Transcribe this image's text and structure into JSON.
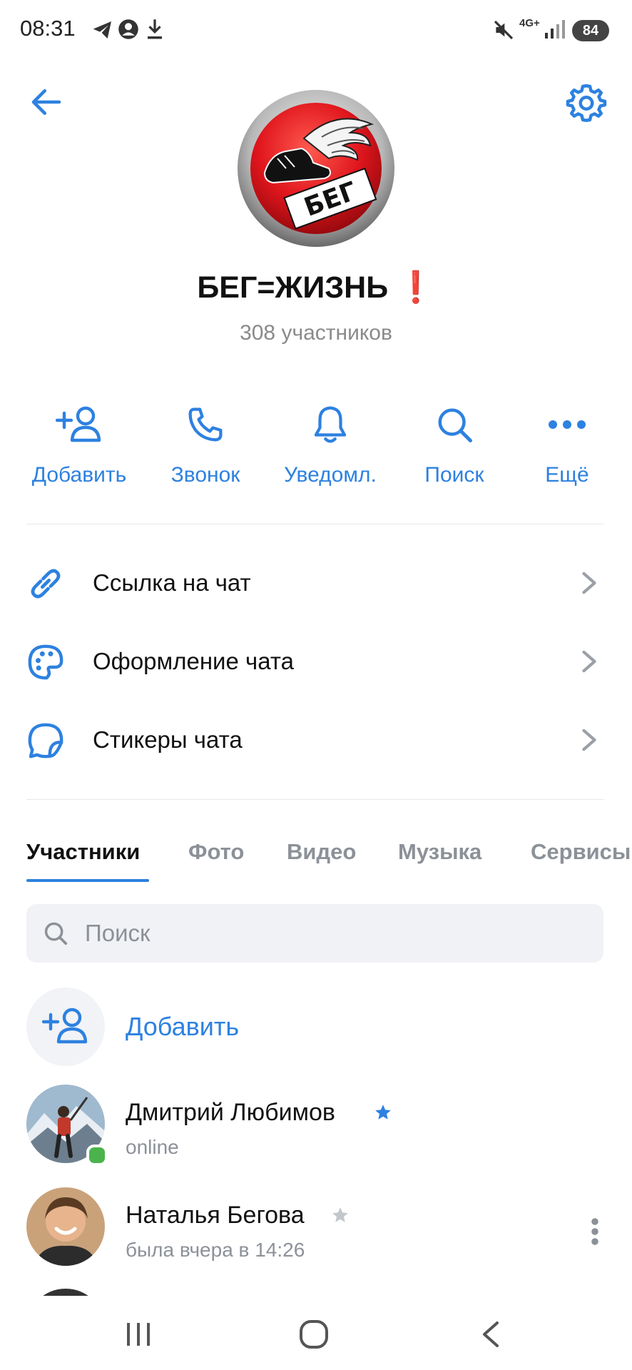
{
  "status_bar": {
    "time": "08:31",
    "network": "4G+",
    "battery": "84"
  },
  "header": {
    "back_icon": "arrow-left-icon",
    "settings_icon": "gear-icon",
    "avatar_text": "БЕГ"
  },
  "chat": {
    "title": "БЕГ=ЖИЗНЬ",
    "title_emoji": "❗",
    "subtitle": "308 участников"
  },
  "actions": [
    {
      "icon": "add-user-icon",
      "label": "Добавить"
    },
    {
      "icon": "phone-icon",
      "label": "Звонок"
    },
    {
      "icon": "bell-icon",
      "label": "Уведомл."
    },
    {
      "icon": "search-icon",
      "label": "Поиск"
    },
    {
      "icon": "more-icon",
      "label": "Ещё"
    }
  ],
  "menu": [
    {
      "icon": "link-icon",
      "label": "Ссылка на чат"
    },
    {
      "icon": "palette-icon",
      "label": "Оформление чата"
    },
    {
      "icon": "sticker-icon",
      "label": "Стикеры чата"
    }
  ],
  "tabs": [
    "Участники",
    "Фото",
    "Видео",
    "Музыка",
    "Сервисы"
  ],
  "active_tab": "Участники",
  "search": {
    "placeholder": "Поиск"
  },
  "add_member": {
    "label": "Добавить"
  },
  "members": [
    {
      "name": "Дмитрий Любимов",
      "status": "online",
      "star": "filled",
      "online": true
    },
    {
      "name": "Наталья Бегова",
      "status": "была вчера в 14:26",
      "star": "outline",
      "online": false
    }
  ],
  "colors": {
    "accent": "#2d81e0",
    "text": "#111111",
    "secondary": "#8c9198",
    "online": "#4bb34b",
    "logo_red": "#e0161d"
  }
}
